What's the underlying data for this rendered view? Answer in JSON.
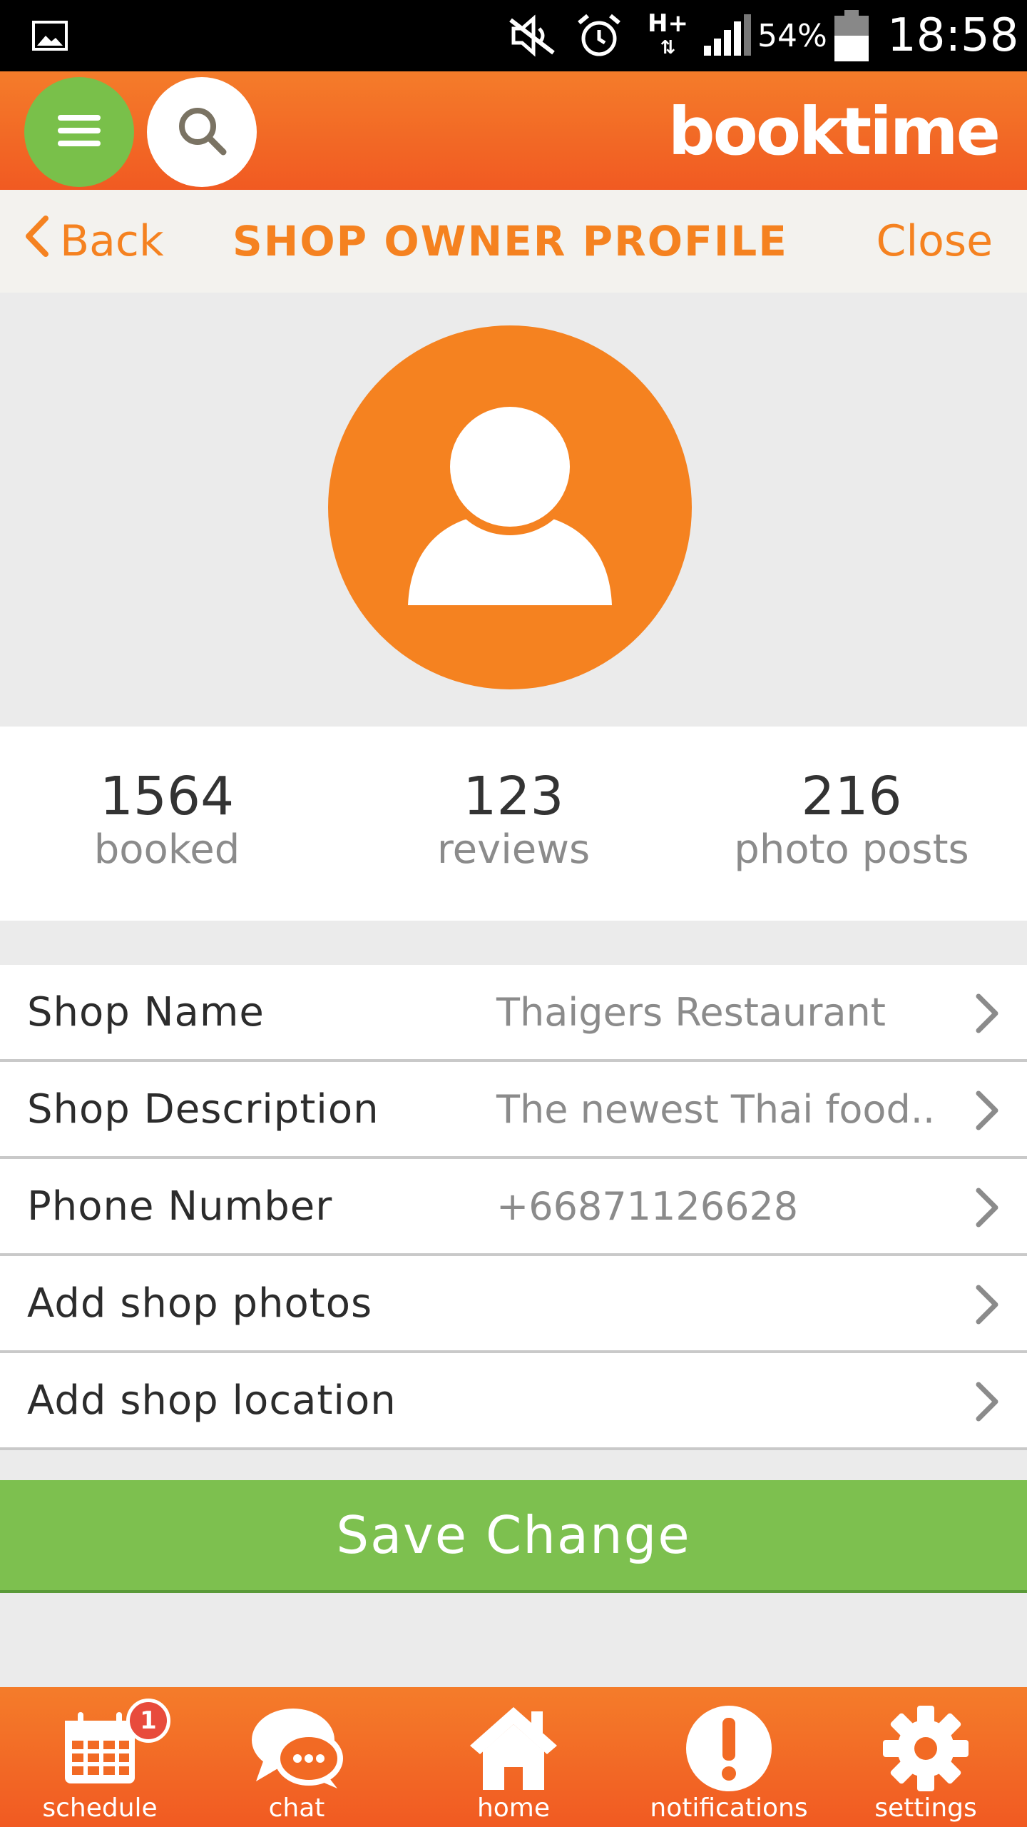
{
  "status_bar": {
    "network": "H+",
    "battery_percent": "54%",
    "time": "18:58",
    "icons": [
      "gallery-icon",
      "mute-icon",
      "alarm-icon",
      "signal-icon",
      "battery-icon"
    ]
  },
  "header": {
    "brand": "booktime",
    "menu_icon": "hamburger-menu-icon",
    "search_icon": "search-icon"
  },
  "nav": {
    "back_label": "Back",
    "title": "SHOP OWNER PROFILE",
    "close_label": "Close"
  },
  "avatar": {
    "icon": "user-avatar-icon"
  },
  "stats": [
    {
      "value": "1564",
      "label": "booked"
    },
    {
      "value": "123",
      "label": "reviews"
    },
    {
      "value": "216",
      "label": "photo posts"
    }
  ],
  "fields": [
    {
      "label": "Shop Name",
      "value": "Thaigers Restaurant"
    },
    {
      "label": "Shop Description",
      "value": "The newest Thai food.."
    },
    {
      "label": "Phone Number",
      "value": "+66871126628"
    },
    {
      "label": "Add shop photos",
      "value": ""
    },
    {
      "label": "Add shop location",
      "value": ""
    }
  ],
  "save_button": {
    "label": "Save Change"
  },
  "tabs": [
    {
      "label": "schedule",
      "icon": "calendar-icon",
      "badge": "1"
    },
    {
      "label": "chat",
      "icon": "chat-icon"
    },
    {
      "label": "home",
      "icon": "home-icon"
    },
    {
      "label": "notifications",
      "icon": "exclamation-icon"
    },
    {
      "label": "settings",
      "icon": "gear-icon"
    }
  ],
  "colors": {
    "brand_orange": "#f58220",
    "header_orange": "#f15a22",
    "green": "#7dc04f",
    "badge_red": "#e84b3c"
  }
}
